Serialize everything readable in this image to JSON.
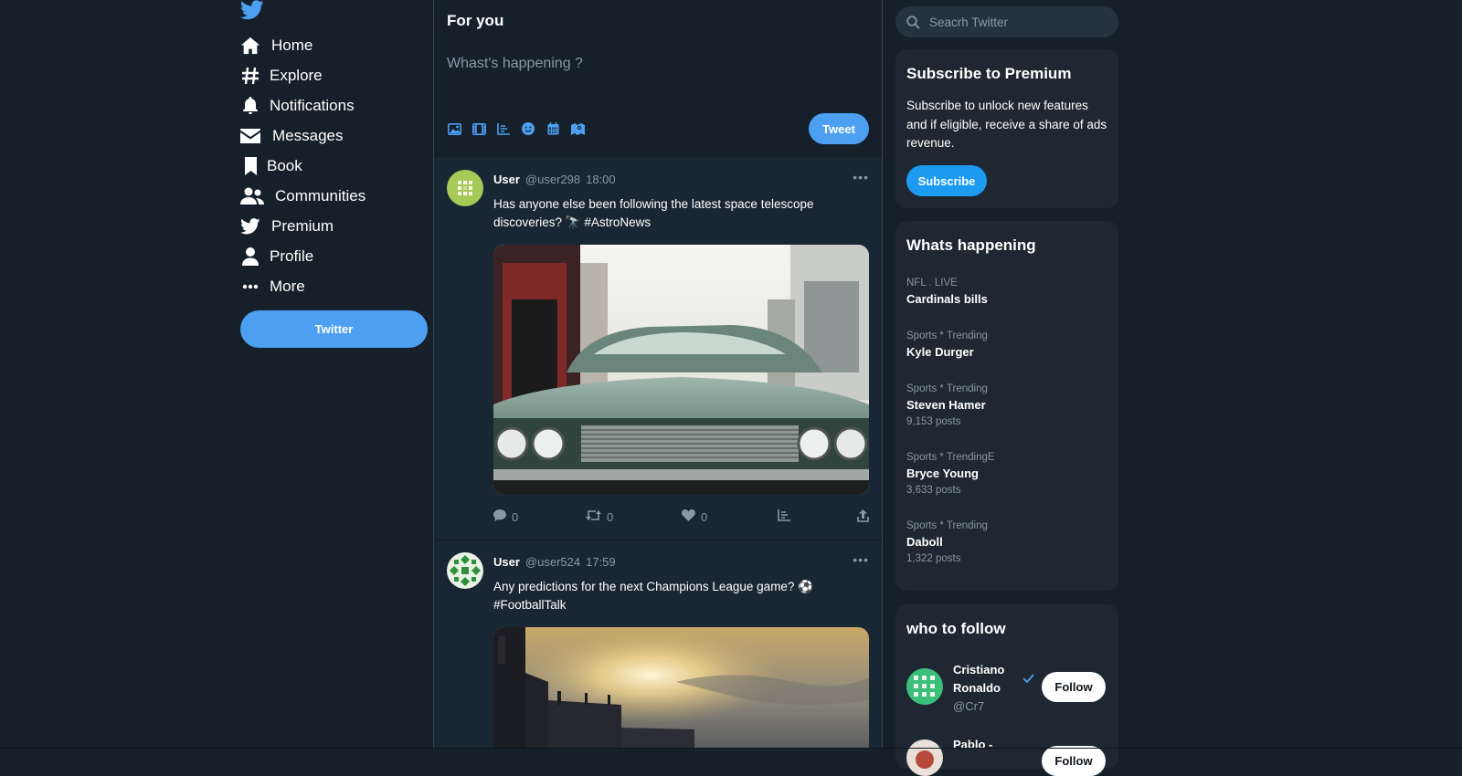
{
  "sidebar": {
    "items": [
      {
        "label": "Home",
        "icon": "home-icon"
      },
      {
        "label": "Explore",
        "icon": "hashtag-icon"
      },
      {
        "label": "Notifications",
        "icon": "bell-icon"
      },
      {
        "label": "Messages",
        "icon": "envelope-icon"
      },
      {
        "label": "Book",
        "icon": "bookmark-icon"
      },
      {
        "label": "Communities",
        "icon": "users-icon"
      },
      {
        "label": "Premium",
        "icon": "twitter-bird-icon"
      },
      {
        "label": "Profile",
        "icon": "user-icon"
      },
      {
        "label": "More",
        "icon": "more-dots-icon"
      }
    ],
    "button_label": "Twitter"
  },
  "feed": {
    "title": "For you",
    "compose_placeholder": "Whast's happening ?",
    "tweet_button": "Tweet",
    "tools": [
      "image-icon",
      "gif-film-icon",
      "poll-chart-icon",
      "emoji-icon",
      "calendar-icon",
      "location-map-icon"
    ]
  },
  "posts": [
    {
      "name": "User",
      "handle": "@user298",
      "time": "18:00",
      "text": "Has anyone else been following the latest space telescope discoveries? 🔭 #AstroNews",
      "image": "vintage green car front grille on city street",
      "replies": "0",
      "retweets": "0",
      "likes": "0"
    },
    {
      "name": "User",
      "handle": "@user524",
      "time": "17:59",
      "text": "Any predictions for the next Champions League game? ⚽ #FootballTalk",
      "image": "sunset sky over pier silhouette"
    }
  ],
  "search": {
    "placeholder": "Seacrh Twitter"
  },
  "premium": {
    "title": "Subscribe to Premium",
    "text": "Subscribe to unlock new features and if eligible, receive a share of ads revenue.",
    "button": "Subscribe"
  },
  "trends": {
    "title": "Whats happening",
    "items": [
      {
        "category": "NFL . LIVE",
        "name": "Cardinals bills",
        "count": ""
      },
      {
        "category": "Sports * Trending",
        "name": "Kyle Durger",
        "count": ""
      },
      {
        "category": "Sports * Trending",
        "name": "Steven Hamer",
        "count": "9,153 posts"
      },
      {
        "category": "Sports * TrendingE",
        "name": "Bryce Young",
        "count": "3,633 posts"
      },
      {
        "category": "Sports * Trending",
        "name": "Daboll",
        "count": "1,322 posts"
      }
    ]
  },
  "follow": {
    "title": "who to follow",
    "items": [
      {
        "name": "Cristiano Ronaldo",
        "handle": "@Cr7",
        "button": "Follow",
        "verified": true
      },
      {
        "name": "Pablo -",
        "handle": "",
        "button": "Follow",
        "verified": false
      }
    ]
  },
  "colors": {
    "background": "#15202b",
    "card": "#1e2732",
    "accent": "#4d9ff2",
    "subscribe": "#1d9bf0",
    "muted": "#8899a6"
  }
}
